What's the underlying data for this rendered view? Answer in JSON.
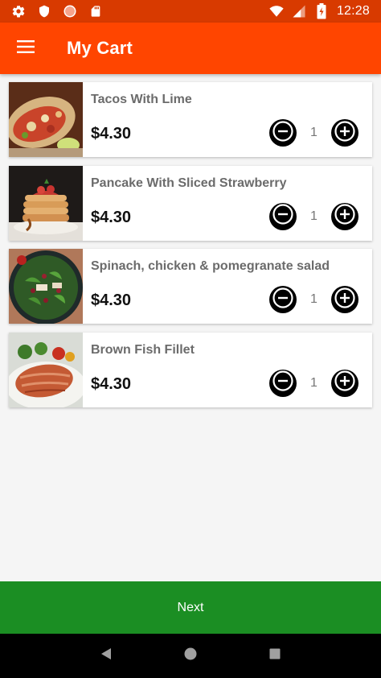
{
  "status_bar": {
    "time": "12:28",
    "left_icons": [
      "settings-icon",
      "shield-icon",
      "record-icon",
      "sd-card-icon"
    ],
    "right_icons": [
      "wifi-icon",
      "signal-icon",
      "battery-icon"
    ]
  },
  "app_bar": {
    "title": "My Cart",
    "menu_icon": "menu-icon"
  },
  "cart": {
    "items": [
      {
        "name": "Tacos With Lime",
        "price": "$4.30",
        "quantity": "1",
        "image": "tacos-image"
      },
      {
        "name": "Pancake With Sliced Strawberry",
        "price": "$4.30",
        "quantity": "1",
        "image": "pancake-image"
      },
      {
        "name": "Spinach, chicken & pomegranate salad",
        "price": "$4.30",
        "quantity": "1",
        "image": "salad-image"
      },
      {
        "name": "Brown Fish Fillet",
        "price": "$4.30",
        "quantity": "1",
        "image": "fish-image"
      }
    ]
  },
  "footer": {
    "next_label": "Next"
  },
  "nav_bar": {
    "icons": [
      "back-icon",
      "home-icon",
      "recents-icon"
    ]
  },
  "colors": {
    "status_bar": "#d83a00",
    "app_bar": "#ff4500",
    "next_bar": "#1b8e23"
  }
}
